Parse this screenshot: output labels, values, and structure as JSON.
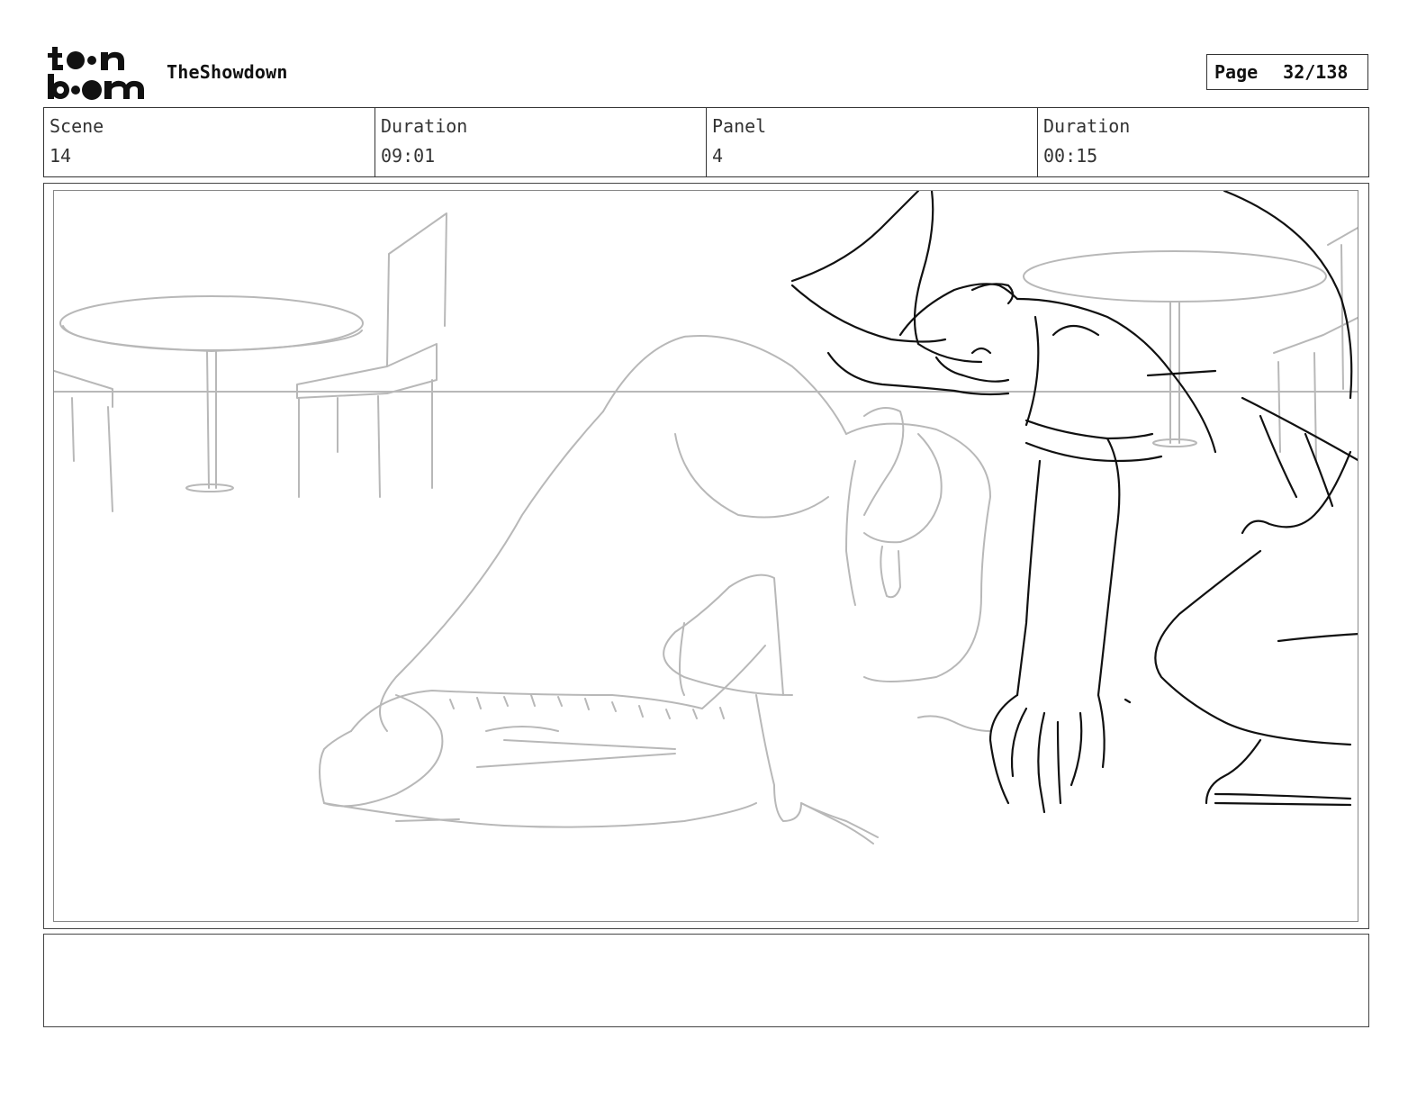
{
  "header": {
    "logo_alt": "toon boom",
    "project_title": "TheShowdown",
    "page_label": "Page",
    "page_number": "32/138"
  },
  "info": {
    "scene_label": "Scene",
    "scene_value": "14",
    "scene_duration_label": "Duration",
    "scene_duration_value": "09:01",
    "panel_label": "Panel",
    "panel_value": "4",
    "panel_duration_label": "Duration",
    "panel_duration_value": "00:15"
  },
  "panel": {
    "sketch": "storyboard-drawing"
  },
  "notes": {
    "text": ""
  }
}
